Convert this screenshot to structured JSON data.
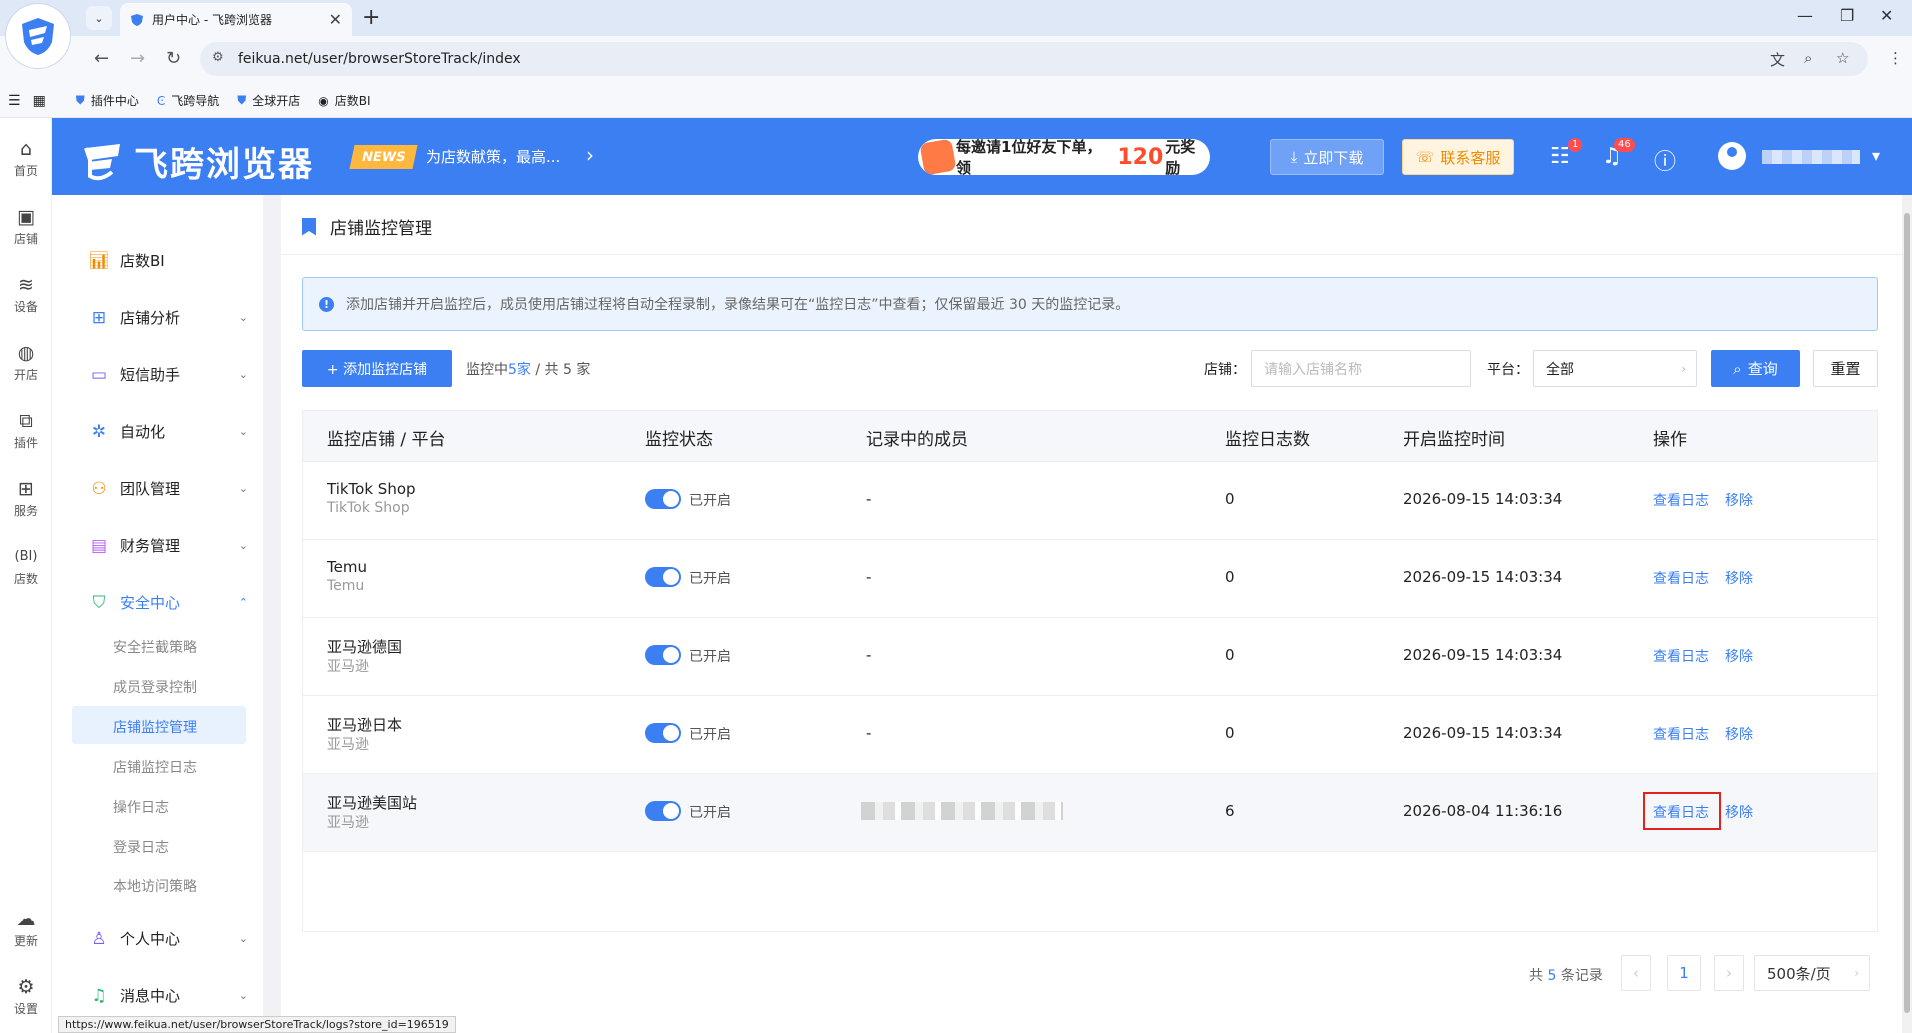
{
  "browser": {
    "tab_title": "用户中心 - 飞跨浏览器",
    "url": "feikua.net/user/browserStoreTrack/index",
    "bookmarks": [
      "插件中心",
      "飞跨导航",
      "全球开店",
      "店数BI"
    ],
    "status_url": "https://www.feikua.net/user/browserStoreTrack/logs?store_id=196519"
  },
  "icon_sidebar": [
    "首页",
    "店铺",
    "设备",
    "开店",
    "插件",
    "服务",
    "店数",
    "更新",
    "设置"
  ],
  "header": {
    "logo": "飞跨浏览器",
    "news_badge": "NEWS",
    "news_text": "为店数献策，最高...",
    "invite_pre": "每邀请1位好友下单，领",
    "invite_num": "120",
    "invite_post": "元奖励",
    "download": "立即下载",
    "customer_service": "联系客服",
    "msg_badge": "1",
    "bell_badge": "46"
  },
  "menu": {
    "items": [
      {
        "label": "店数BI",
        "icon": "bar-chart-icon"
      },
      {
        "label": "店铺分析",
        "icon": "grid-icon"
      },
      {
        "label": "短信助手",
        "icon": "message-icon"
      },
      {
        "label": "自动化",
        "icon": "gear-icon"
      },
      {
        "label": "团队管理",
        "icon": "team-icon"
      },
      {
        "label": "财务管理",
        "icon": "wallet-icon"
      },
      {
        "label": "安全中心",
        "icon": "shield-icon"
      }
    ],
    "security_sub": [
      "安全拦截策略",
      "成员登录控制",
      "店铺监控管理",
      "店铺监控日志",
      "操作日志",
      "登录日志",
      "本地访问策略"
    ],
    "personal": "个人中心",
    "message": "消息中心"
  },
  "page": {
    "title": "店铺监控管理",
    "notice": "添加店铺并开启监控后，成员使用店铺过程将自动全程录制，录像结果可在“监控日志”中查看；仅保留最近 30 天的监控记录。",
    "add_button": "+ 添加监控店铺",
    "count_pre": "监控中",
    "count_active": "5家",
    "count_post": " / 共 5 家",
    "store_label": "店铺：",
    "store_placeholder": "请输入店铺名称",
    "platform_label": "平台：",
    "platform_value": "全部",
    "query": "查询",
    "reset": "重置"
  },
  "table": {
    "headers": [
      "监控店铺 / 平台",
      "监控状态",
      "记录中的成员",
      "监控日志数",
      "开启监控时间",
      "操作"
    ],
    "rows": [
      {
        "store": "TikTok Shop",
        "platform": "TikTok Shop",
        "status": "已开启",
        "member": "-",
        "logs": "0",
        "time": "2026-09-15 14:03:34"
      },
      {
        "store": "Temu",
        "platform": "Temu",
        "status": "已开启",
        "member": "-",
        "logs": "0",
        "time": "2026-09-15 14:03:34"
      },
      {
        "store": "亚马逊德国",
        "platform": "亚马逊",
        "status": "已开启",
        "member": "-",
        "logs": "0",
        "time": "2026-09-15 14:03:34"
      },
      {
        "store": "亚马逊日本",
        "platform": "亚马逊",
        "status": "已开启",
        "member": "-",
        "logs": "0",
        "time": "2026-09-15 14:03:34"
      },
      {
        "store": "亚马逊美国站",
        "platform": "亚马逊",
        "status": "已开启",
        "member": "",
        "logs": "6",
        "time": "2026-08-04 11:36:16"
      }
    ],
    "op_view": "查看日志",
    "op_remove": "移除"
  },
  "pager": {
    "total_pre": "共 ",
    "total": "5",
    "total_post": " 条记录",
    "current": "1",
    "page_size": "500条/页"
  }
}
